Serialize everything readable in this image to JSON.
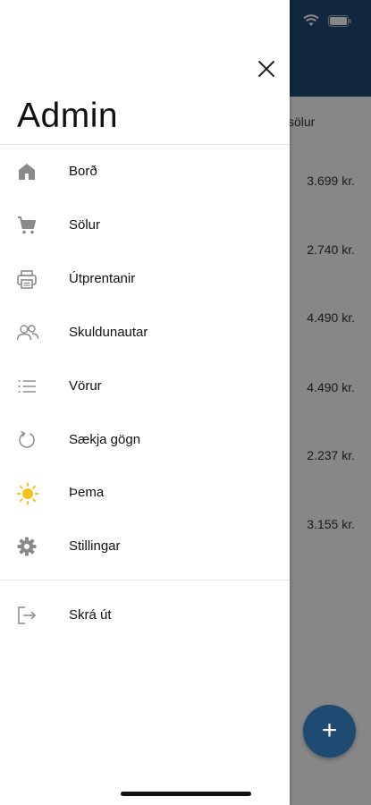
{
  "background": {
    "column_label": "sölur",
    "amounts": [
      "3.699 kr.",
      "2.740 kr.",
      "4.490 kr.",
      "4.490 kr.",
      "2.237 kr.",
      "3.155 kr."
    ],
    "fab_label": "+"
  },
  "drawer": {
    "title": "Admin",
    "menu": [
      {
        "label": "Borð",
        "icon": "home-icon"
      },
      {
        "label": "Sölur",
        "icon": "cart-icon"
      },
      {
        "label": "Útprentanir",
        "icon": "printer-icon"
      },
      {
        "label": "Skuldunautar",
        "icon": "people-icon"
      },
      {
        "label": "Vörur",
        "icon": "list-icon"
      },
      {
        "label": "Sækja gögn",
        "icon": "refresh-icon"
      },
      {
        "label": "Þema",
        "icon": "sun-icon"
      },
      {
        "label": "Stillingar",
        "icon": "gear-icon"
      }
    ],
    "logout": {
      "label": "Skrá út",
      "icon": "logout-icon"
    }
  },
  "colors": {
    "header": "#1f4b73",
    "sun": "#f6c21b",
    "icon_gray": "#8a8a8a"
  }
}
